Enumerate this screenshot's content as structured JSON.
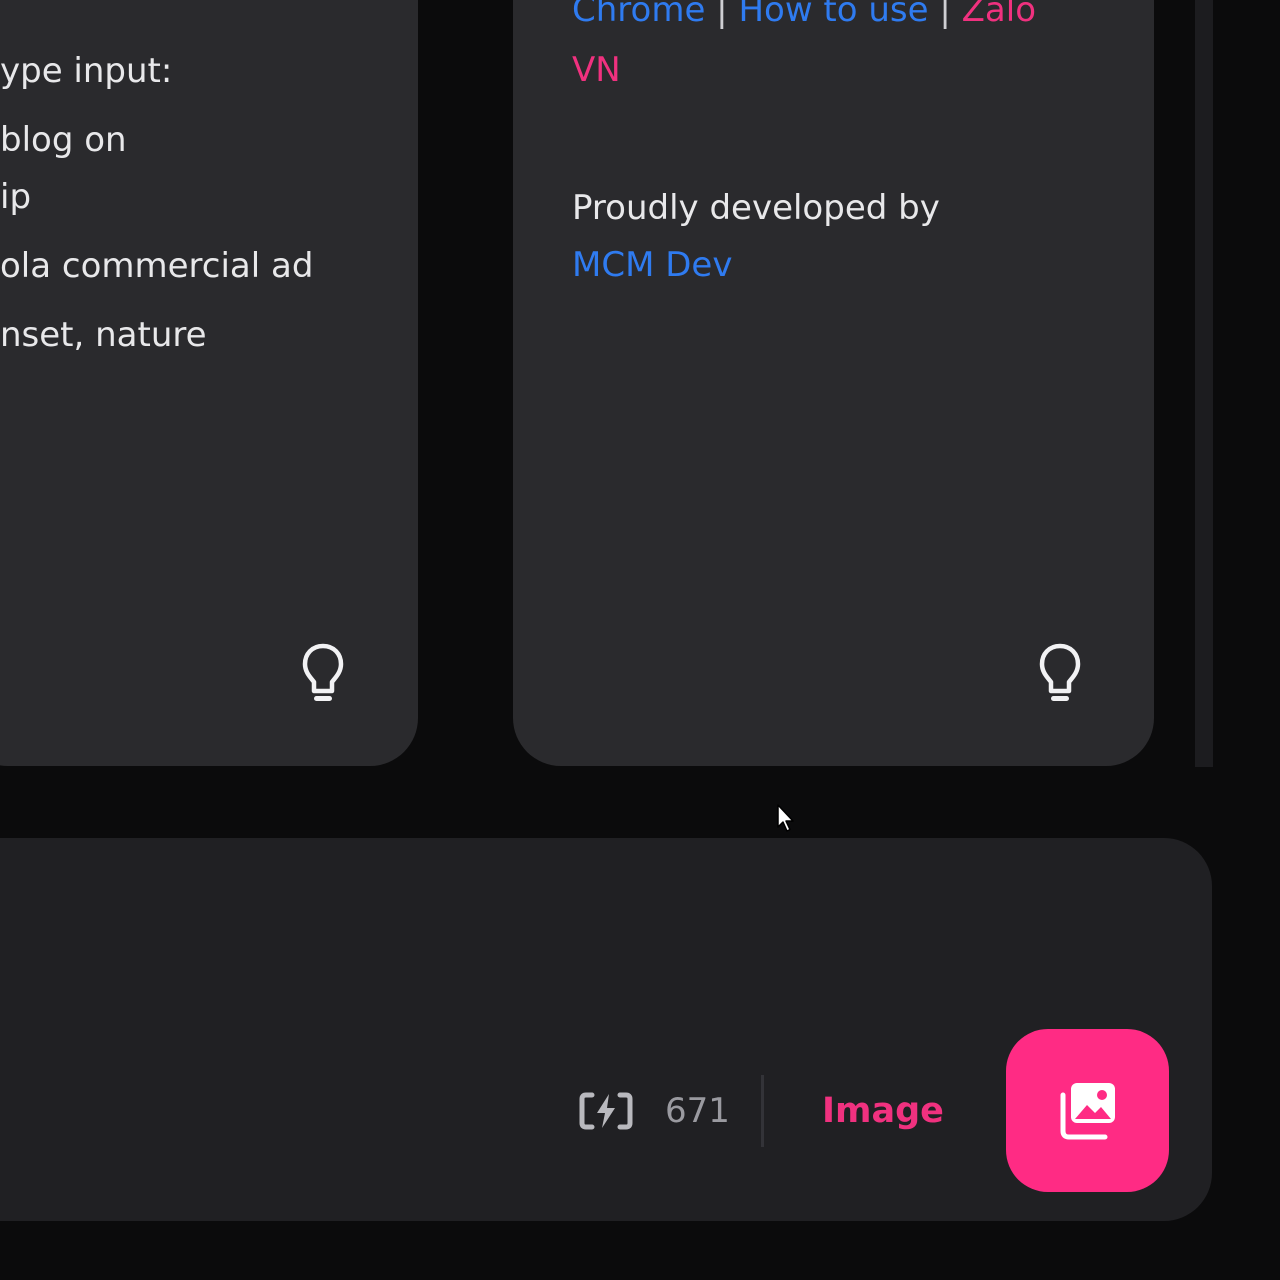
{
  "left_card": {
    "lines": [
      "ype input:",
      " blog on",
      "ip",
      "ola commercial ad",
      "nset, nature"
    ],
    "icon": "lightbulb-icon"
  },
  "right_card": {
    "links": {
      "chrome": "Chrome",
      "sep1": " | ",
      "how_to_use": "How to use",
      "sep2": " | ",
      "zalo": "Zalo",
      "vn": "VN"
    },
    "credit_text": "Proudly developed by",
    "credit_link": "MCM Dev",
    "icon": "lightbulb-icon"
  },
  "composer": {
    "credits_icon": "bolt-credits-icon",
    "credits_count": "671",
    "mode_label": "Image",
    "generate_icon": "image-gallery-icon"
  },
  "colors": {
    "accent": "#ff2b84",
    "link_blue": "#2f7bf0",
    "link_pink": "#f0317f",
    "card_bg": "#2a2a2d",
    "panel_bg": "#202023",
    "page_bg": "#0b0b0c"
  }
}
